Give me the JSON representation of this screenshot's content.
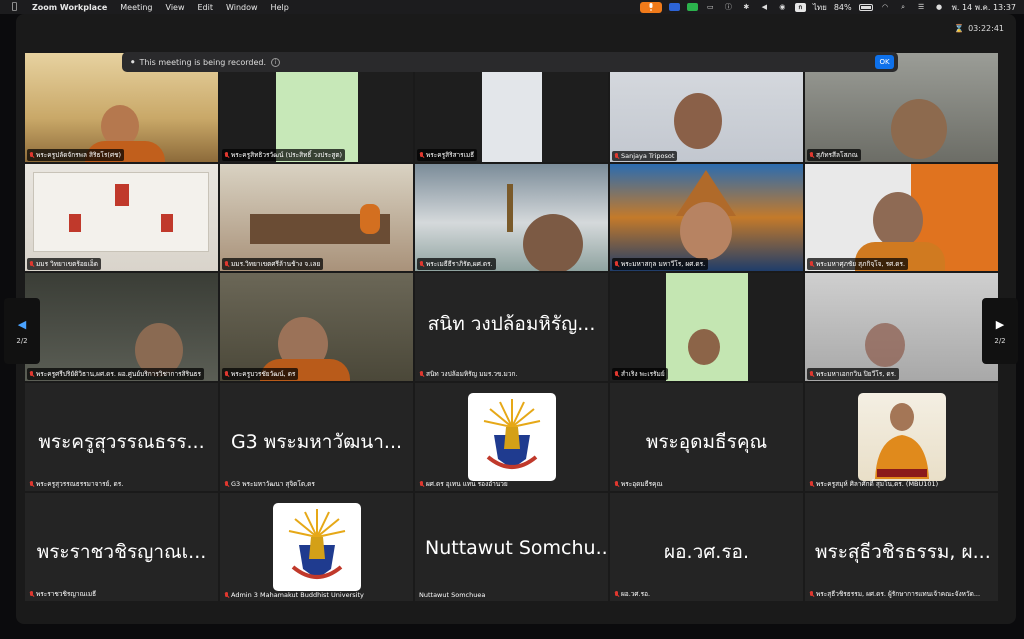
{
  "menubar": {
    "app_name": "Zoom Workplace",
    "menus": [
      "Meeting",
      "View",
      "Edit",
      "Window",
      "Help"
    ],
    "battery": "84%",
    "lang": "ไทย",
    "date_time": "พ. 14 พ.ค.  13:37",
    "status_icons": [
      "mic-icon",
      "sound-icon",
      "line-icon",
      "screen-icon",
      "info-icon",
      "bluetooth-icon",
      "volume-icon",
      "zoom-icon",
      "wifi-icon",
      "search-icon",
      "control-center-icon",
      "siri-icon"
    ]
  },
  "meeting": {
    "timer": "03:22:41",
    "recording_notice": "This meeting is being recorded.",
    "ok_label": "OK",
    "page": "2/2"
  },
  "row1": [
    {
      "name": "พระครูปลัดจักรพล สิริธโร(ศช)"
    },
    {
      "name": "พระครูสิทธิวรวัฒน์ (ประสิทธิ์ วงประสูต)"
    },
    {
      "name": "พระครูสิริสารเมธี"
    },
    {
      "name": "Sanjaya Triposot"
    },
    {
      "name": "สุภัทรสีลโสภณ"
    }
  ],
  "row2": [
    {
      "name": "มมร วิทยาเขตร้อยเอ็ด"
    },
    {
      "name": "มมร.วิทยาเขตศรีล้านช้าง จ.เลย"
    },
    {
      "name": "พระเมธีธีราภิรัต,ผศ.ดร."
    },
    {
      "name": "พระมหาสกุล มหาวีโร, ผศ.ดร."
    },
    {
      "name": "พระมหาศุภชัย สุภกิจฺโจ, รศ.ดร."
    }
  ],
  "row3": [
    {
      "name": "พระครูศรีปริยัติวิธาน,ผศ.ดร. ผอ.ศูนย์บริการวิชาการสิรินธร"
    },
    {
      "name": "พระครูบวรชัยวัฒน์, ดร"
    },
    {
      "big": "สนิท  วงปล้อมหิรัญ...",
      "name": "สนิท  วงปล้อมหิรัญ มมร.วข.มวก."
    },
    {
      "name": "สำเริง พะเรรัมย์"
    },
    {
      "name": "พระมหาเอกกวิน ปิยวีโร, ดร."
    }
  ],
  "row4": [
    {
      "big": "พระครูสุวรรณธรร...",
      "name": "พระครูสุวรรณธรรมาจารย์, ดร."
    },
    {
      "big": "G3 พระมหาวัฒนา...",
      "name": "G3 พระมหาวัฒนา สุจิตโต,ดร"
    },
    {
      "name": "ผศ.ดร อุเทน แทน รองอ้ำนวย"
    },
    {
      "big": "พระอุดมธีรคุณ",
      "name": "พระอุดมธีรคุณ"
    },
    {
      "name": "พระครูสมุห์ ศิลาศักดิ์ สุมโน,ดร. (MBU101)"
    }
  ],
  "row5": [
    {
      "big": "พระราชวชิรญาณเ...",
      "name": "พระราชวชิรญาณเมธี"
    },
    {
      "name": "Admin 3 Mahamakut Buddhist University"
    },
    {
      "big": "Nuttawut Somchu...",
      "name": "Nuttawut Somchuea"
    },
    {
      "big": "ผอ.วศ.รอ.",
      "name": "ผอ.วศ.รอ."
    },
    {
      "big": "พระสุธีวชิรธรรม, ผ...",
      "name": "พระสุธีวชิรธรรม, ผศ.ดร. ผู้รักษาการแทนเจ้าคณะจังหวัด..."
    }
  ],
  "colors": {
    "recording_ok": "#0e71eb",
    "mic_off": "#e0382f",
    "zoom_bg": "#1a1a1a"
  }
}
